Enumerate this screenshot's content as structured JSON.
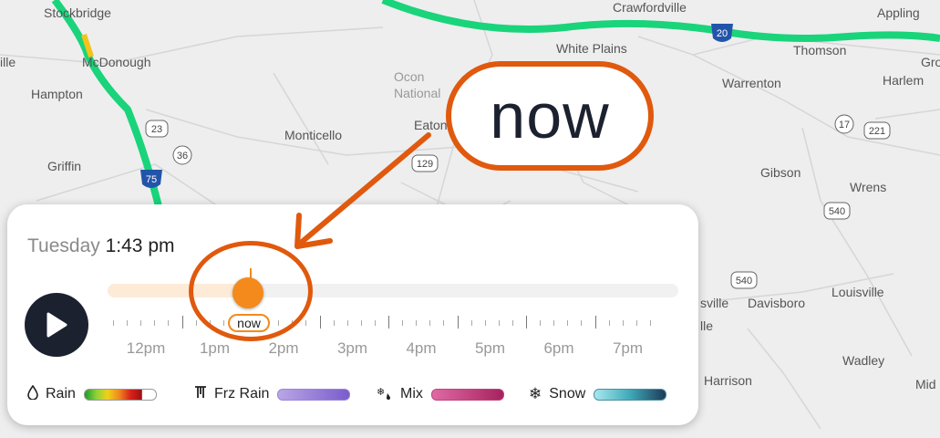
{
  "map": {
    "towns": [
      "Stockbridge",
      "McDonough",
      "Hampton",
      "Griffin",
      "Monticello",
      "Crawfordville",
      "White Plains",
      "Warrenton",
      "Thomson",
      "Appling",
      "Harlem",
      "Gibson",
      "Wrens",
      "Louisville",
      "Davisboro",
      "Wadley",
      "Harrison",
      "Eaton",
      "Ocon National",
      "Mid",
      "ille",
      "Gro",
      "sville",
      "lle"
    ],
    "shields": [
      "23",
      "36",
      "75",
      "129",
      "20",
      "17",
      "221",
      "540",
      "540"
    ]
  },
  "panel": {
    "day": "Tuesday",
    "time": "1:43 pm",
    "now_label": "now",
    "hours": [
      "12pm",
      "1pm",
      "2pm",
      "3pm",
      "4pm",
      "5pm",
      "6pm",
      "7pm"
    ],
    "progress": 0.24
  },
  "legend": [
    {
      "label": "Rain",
      "icon": "raindrop-icon",
      "glyph": "💧"
    },
    {
      "label": "Frz Rain",
      "icon": "freezing-rain-icon",
      "glyph": "₸"
    },
    {
      "label": "Mix",
      "icon": "mix-icon",
      "glyph": "❄"
    },
    {
      "label": "Snow",
      "icon": "snowflake-icon",
      "glyph": "❄"
    }
  ],
  "annotation": {
    "callout_text": "now"
  },
  "colors": {
    "accent": "#f48a1c",
    "annotation": "#e0590d",
    "road": "#19d47a",
    "play_bg": "#1c2130"
  }
}
